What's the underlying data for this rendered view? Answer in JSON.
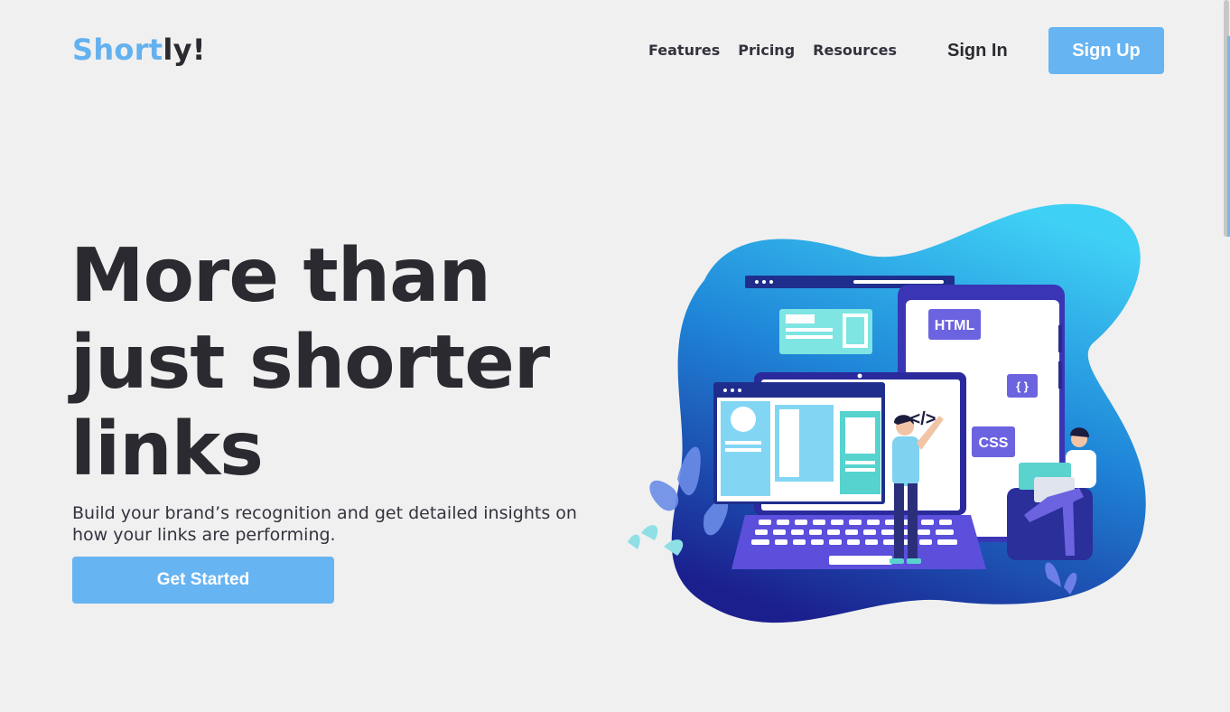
{
  "header": {
    "logo_part1": "Short",
    "logo_part2": "ly!",
    "nav": [
      "Features",
      "Pricing",
      "Resources"
    ],
    "sign_in": "Sign In",
    "sign_up": "Sign Up"
  },
  "hero": {
    "title_lines": [
      "More than",
      "just shorter",
      "links"
    ],
    "subtitle": "Build your brand’s recognition and get detailed insights on how your links are performing.",
    "cta": "Get Started"
  },
  "illustration": {
    "tags": [
      "HTML",
      "{ }",
      "CSS",
      "</>"
    ]
  },
  "colors": {
    "accent": "#67b4f2",
    "text": "#2b2a30",
    "background": "#f0f0f0",
    "blob_light": "#36c3f0",
    "blob_dark": "#1d2a9a"
  }
}
